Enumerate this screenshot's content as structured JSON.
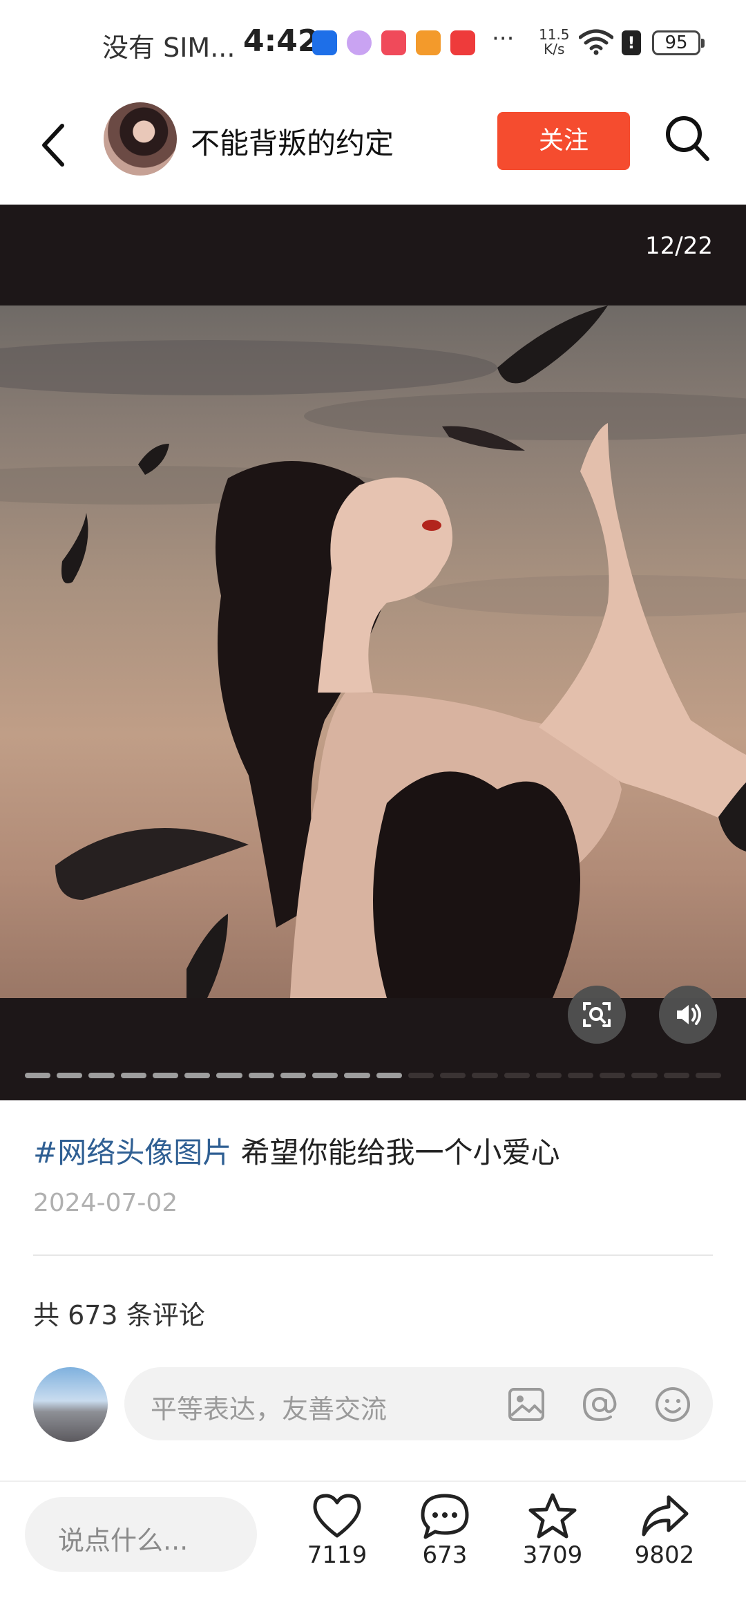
{
  "status_bar": {
    "carrier": "没有 SIM...",
    "time": "4:42",
    "more": "···",
    "net_speed_value": "11.5",
    "net_speed_unit": "K/s",
    "battery": "95"
  },
  "header": {
    "username": "不能背叛的约定",
    "follow_label": "关注"
  },
  "viewer": {
    "counter": "12/22",
    "current_index": 12,
    "total": 22,
    "active_dot_color": "#9e9e9e",
    "inactive_dot_color": "#3a3333"
  },
  "post": {
    "hashtag": "#网络头像图片",
    "text": " 希望你能给我一个小爱心",
    "date": "2024-07-02",
    "comment_count_label": "共 673 条评论"
  },
  "comment_input": {
    "placeholder": "平等表达，友善交流",
    "icons": [
      "image-icon",
      "at-icon",
      "emoji-icon"
    ]
  },
  "bottom_bar": {
    "say_placeholder": "说点什么...",
    "likes": "7119",
    "comments": "673",
    "favorites": "3709",
    "shares": "9802"
  },
  "colors": {
    "accent": "#f54c2f",
    "hashtag": "#2f5f93"
  }
}
